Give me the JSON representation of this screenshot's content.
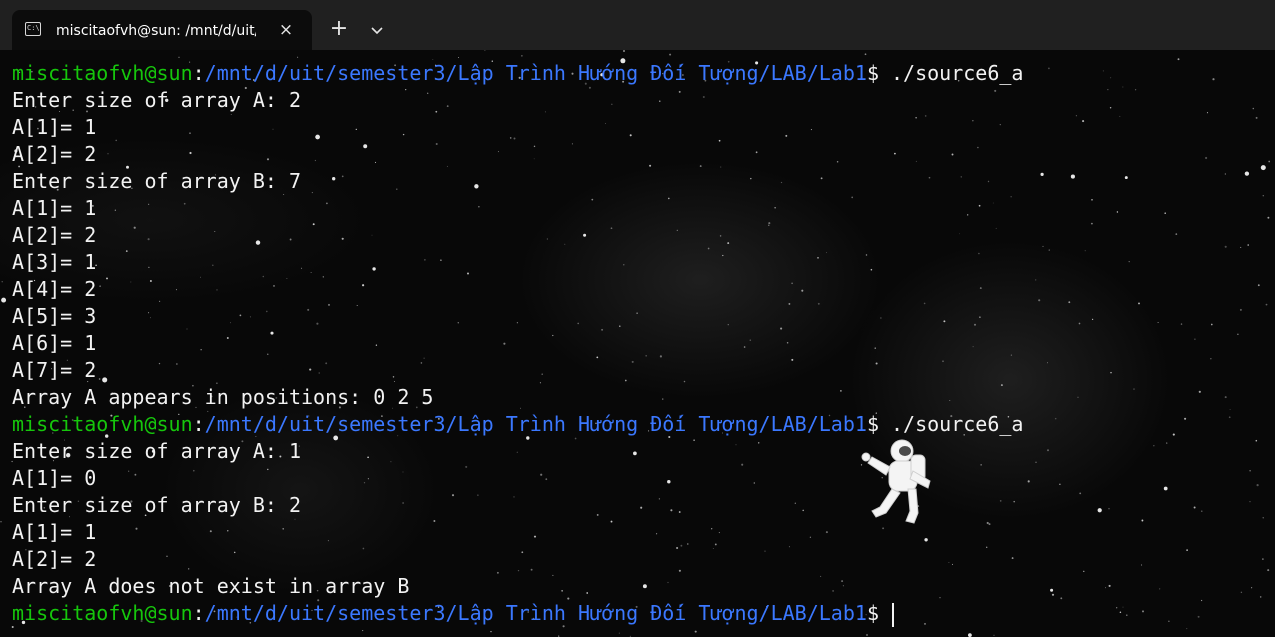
{
  "tab": {
    "title": "miscitaofvh@sun: /mnt/d/uit/",
    "icon": "terminal-icon",
    "close_icon": "×",
    "new_tab_icon": "+",
    "dropdown_icon": "chevron-down-icon"
  },
  "colors": {
    "user": "#16c60c",
    "path": "#3b78ff",
    "text": "#f2f2f2",
    "tabbar": "#202020"
  },
  "terminal": {
    "lines": [
      {
        "user": "miscitaofvh@sun",
        "sep": ":",
        "path": "/mnt/d/uit/semester3/Lập Trình Hướng Đối Tượng/LAB/Lab1",
        "rest": "$ ./source6_a"
      },
      {
        "text": "Enter size of array A: 2"
      },
      {
        "text": "A[1]= 1"
      },
      {
        "text": "A[2]= 2"
      },
      {
        "text": "Enter size of array B: 7"
      },
      {
        "text": "A[1]= 1"
      },
      {
        "text": "A[2]= 2"
      },
      {
        "text": "A[3]= 1"
      },
      {
        "text": "A[4]= 2"
      },
      {
        "text": "A[5]= 3"
      },
      {
        "text": "A[6]= 1"
      },
      {
        "text": "A[7]= 2"
      },
      {
        "text": "Array A appears in positions: 0 2 5"
      },
      {
        "user": "miscitaofvh@sun",
        "sep": ":",
        "path": "/mnt/d/uit/semester3/Lập Trình Hướng Đối Tượng/LAB/Lab1",
        "rest": "$ ./source6_a"
      },
      {
        "text": "Enter size of array A: 1"
      },
      {
        "text": "A[1]= 0"
      },
      {
        "text": "Enter size of array B: 2"
      },
      {
        "text": "A[1]= 1"
      },
      {
        "text": "A[2]= 2"
      },
      {
        "text": "Array A does not exist in array B"
      },
      {
        "user": "miscitaofvh@sun",
        "sep": ":",
        "path": "/mnt/d/uit/semester3/Lập Trình Hướng Đối Tượng/LAB/Lab1",
        "rest": "$ ",
        "cursor": true
      }
    ]
  }
}
